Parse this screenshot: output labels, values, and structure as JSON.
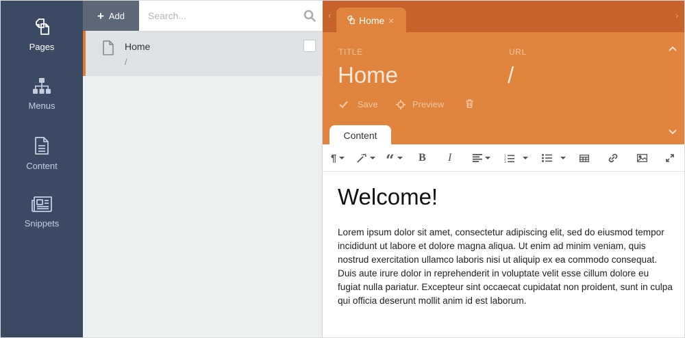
{
  "nav": {
    "items": [
      {
        "label": "Pages",
        "icon": "pages-icon"
      },
      {
        "label": "Menus",
        "icon": "sitemap-icon"
      },
      {
        "label": "Content",
        "icon": "document-icon"
      },
      {
        "label": "Snippets",
        "icon": "newspaper-icon"
      }
    ],
    "active": "Pages"
  },
  "pages_panel": {
    "add_label": "Add",
    "search_placeholder": "Search...",
    "pages": [
      {
        "title": "Home",
        "url": "/",
        "selected": true
      }
    ]
  },
  "editor": {
    "tab_label": "Home",
    "title_label": "TITLE",
    "title_value": "Home",
    "url_label": "URL",
    "url_value": "/",
    "save_label": "Save",
    "preview_label": "Preview",
    "content_tab_label": "Content",
    "toolbar": [
      "paragraph-icon",
      "magic-wand-icon",
      "quote-icon",
      "bold-icon",
      "italic-icon",
      "align-icon",
      "ordered-list-icon",
      "unordered-list-icon",
      "table-icon",
      "link-icon",
      "image-icon",
      "fullscreen-icon"
    ],
    "body_heading": "Welcome!",
    "body_text": "Lorem ipsum dolor sit amet, consectetur adipiscing elit, sed do eiusmod tempor incididunt ut labore et dolore magna aliqua. Ut enim ad minim veniam, quis nostrud exercitation ullamco laboris nisi ut aliquip ex ea commodo consequat. Duis aute irure dolor in reprehenderit in voluptate velit esse cillum dolore eu fugiat nulla pariatur. Excepteur sint occaecat cupidatat non proident, sunt in culpa qui officia deserunt mollit anim id est laborum."
  },
  "colors": {
    "nav_bg": "#3b4a63",
    "accent_orange": "#e0843d",
    "tabbar_orange": "#c8622a",
    "panel_bg": "#edf0f1",
    "add_button_bg": "#5c6778"
  }
}
